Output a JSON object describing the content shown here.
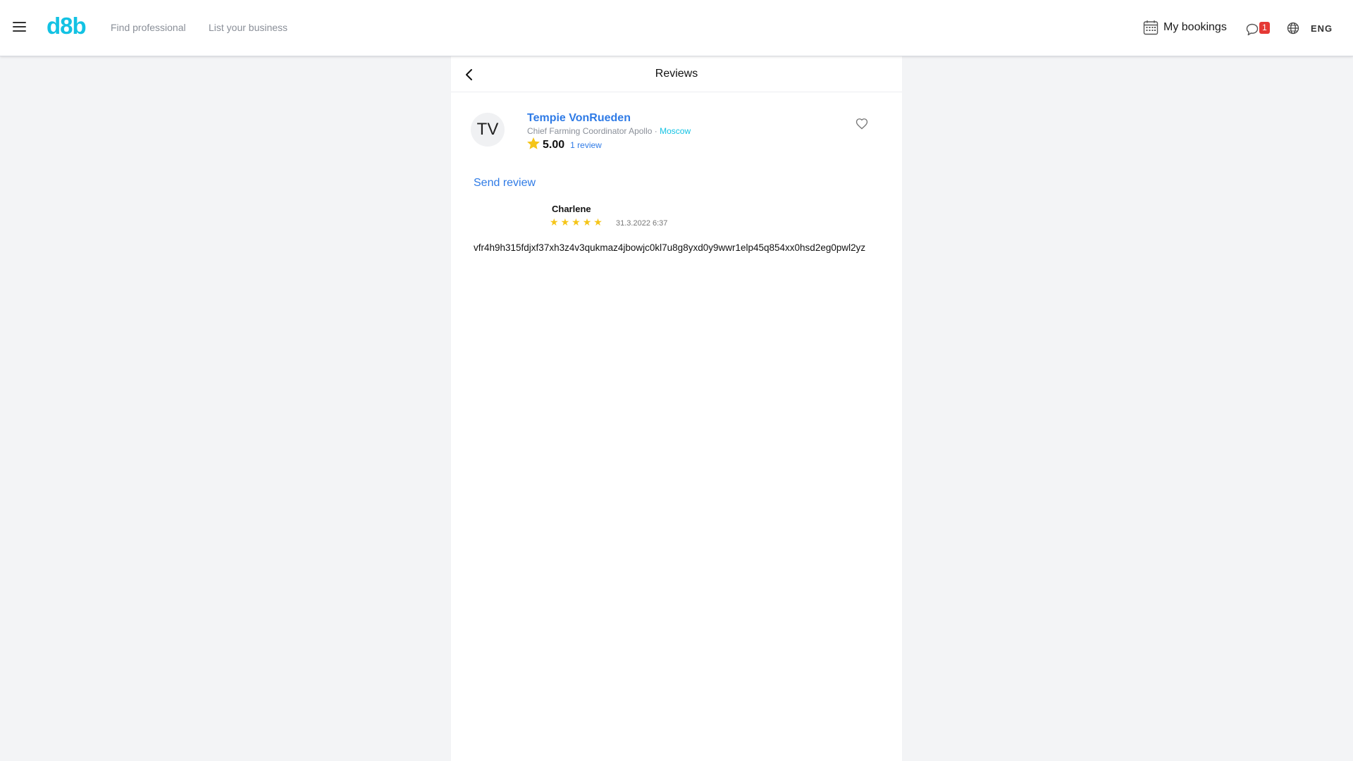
{
  "header": {
    "logo": "d8b",
    "nav": {
      "find_professional": "Find professional",
      "list_business": "List your business"
    },
    "bookings_label": "My bookings",
    "chat_badge": "1",
    "language": "ENG"
  },
  "page": {
    "title": "Reviews"
  },
  "professional": {
    "initials": "TV",
    "name": "Tempie VonRueden",
    "position": "Chief Farming Coordinator Apollo",
    "separator": " · ",
    "city": "Moscow",
    "rating": "5.00",
    "reviews_link": "1 review"
  },
  "send_review_label": "Send review",
  "reviews": [
    {
      "author": "Charlene",
      "rating": 5,
      "date": "31.3.2022 6:37",
      "text": "vfr4h9h315fdjxf37xh3z4v3qukmaz4jbowjc0kl7u8g8yxd0y9wwr1elp45q854xx0hsd2eg0pwl2yz"
    }
  ],
  "colors": {
    "brand": "#13c2e3",
    "link": "#2f7be6",
    "star": "#f5c518",
    "badge": "#e53935"
  },
  "icons": {
    "menu": "hamburger-icon",
    "calendar": "calendar-icon",
    "chat": "chat-icon",
    "globe": "globe-icon",
    "back": "chevron-left-icon",
    "favorite": "heart-icon",
    "star": "star-icon"
  }
}
